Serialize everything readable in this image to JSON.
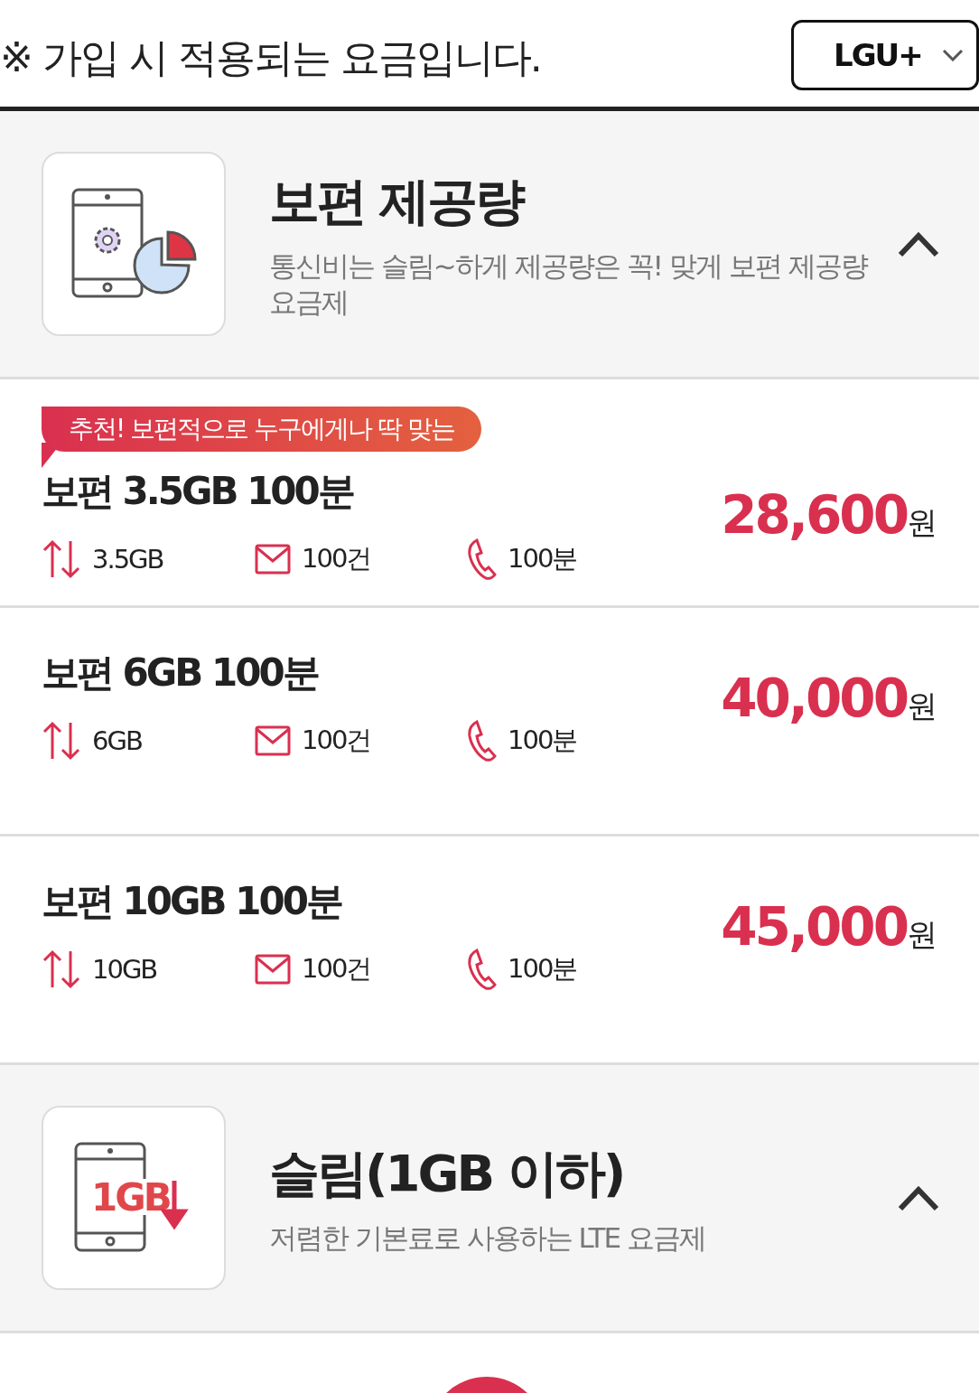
{
  "notice": "※ 가입 시 적용되는 요금입니다.",
  "carrier_select": {
    "value": "LGU+"
  },
  "categories": [
    {
      "kind": "usage",
      "title": "보편 제공량",
      "description": "통신비는 슬림~하게 제공량은 꼭! 맞게 보편 제공량 요금제",
      "expanded": true,
      "plans": [
        {
          "badge": "추천! 보편적으로 누구에게나 딱 맞는",
          "name": "보편 3.5GB 100분",
          "data": "3.5GB",
          "sms": "100건",
          "voice": "100분",
          "price": "28,600",
          "unit": "원"
        },
        {
          "name": "보편 6GB 100분",
          "data": "6GB",
          "sms": "100건",
          "voice": "100분",
          "price": "40,000",
          "unit": "원"
        },
        {
          "name": "보편 10GB 100분",
          "data": "10GB",
          "sms": "100건",
          "voice": "100분",
          "price": "45,000",
          "unit": "원"
        }
      ]
    },
    {
      "kind": "slim",
      "icon_label": "1GB",
      "title": "슬림(1GB 이하)",
      "description": "저렴한 기본료로 사용하는 LTE 요금제",
      "expanded": true
    }
  ]
}
